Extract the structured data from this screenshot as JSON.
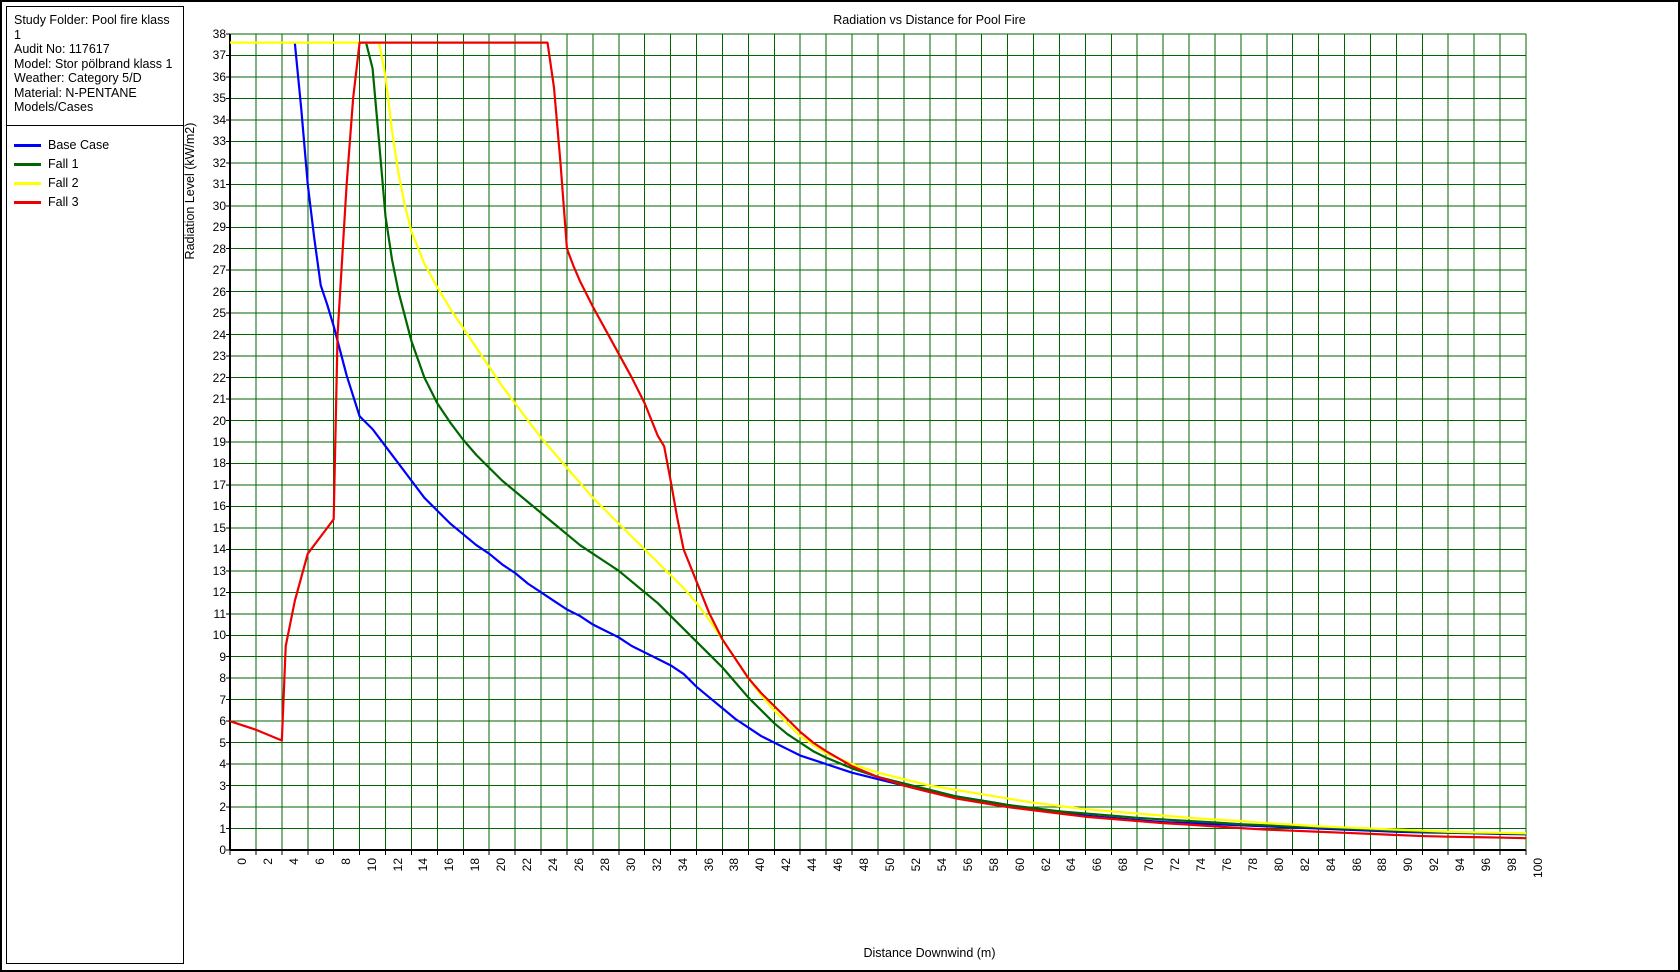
{
  "info": {
    "lines": [
      "Study Folder: Pool fire klass 1",
      "Audit No: 117617",
      "Model: Stor pölbrand klass 1",
      "Weather: Category 5/D",
      "Material: N-PENTANE",
      "Models/Cases"
    ]
  },
  "legend": {
    "items": [
      {
        "label": "Base Case",
        "color": "#0000ff"
      },
      {
        "label": "Fall 1",
        "color": "#006600"
      },
      {
        "label": "Fall 2",
        "color": "#ffff00"
      },
      {
        "label": "Fall 3",
        "color": "#ee0000"
      }
    ]
  },
  "chart_data": {
    "type": "line",
    "title": "Radiation vs Distance for Pool Fire",
    "xlabel": "Distance Downwind (m)",
    "ylabel": "Radiation Level (kW/m2)",
    "xlim": [
      0,
      100
    ],
    "ylim": [
      0,
      38
    ],
    "xticks": [
      0,
      2,
      4,
      6,
      8,
      10,
      12,
      14,
      16,
      18,
      20,
      22,
      24,
      26,
      28,
      30,
      32,
      34,
      36,
      38,
      40,
      42,
      44,
      46,
      48,
      50,
      52,
      54,
      56,
      58,
      60,
      62,
      64,
      66,
      68,
      70,
      72,
      74,
      76,
      78,
      80,
      82,
      84,
      86,
      88,
      90,
      92,
      94,
      96,
      98,
      100
    ],
    "yticks": [
      0,
      1,
      2,
      3,
      4,
      5,
      6,
      7,
      8,
      9,
      10,
      11,
      12,
      13,
      14,
      15,
      16,
      17,
      18,
      19,
      20,
      21,
      22,
      23,
      24,
      25,
      26,
      27,
      28,
      29,
      30,
      31,
      32,
      33,
      34,
      35,
      36,
      37,
      38
    ],
    "grid": true,
    "grid_color": "#006600",
    "legend_position": "left-panel",
    "series": [
      {
        "name": "Base Case",
        "color": "#0000ff",
        "x": [
          5.0,
          5.5,
          6.0,
          6.5,
          7.0,
          7.5,
          8.0,
          9.0,
          10.0,
          11.0,
          12.0,
          13.0,
          14.0,
          15.0,
          16.0,
          17.0,
          18.0,
          19.0,
          20.0,
          21.0,
          22.0,
          23.0,
          24.0,
          25.0,
          26.0,
          27.0,
          28.0,
          29.0,
          30.0,
          31.0,
          32.0,
          33.0,
          34.0,
          35.0,
          36.0,
          37.0,
          38.0,
          39.0,
          40.0,
          41.0,
          42.0,
          43.0,
          44.0,
          45.0,
          46.0,
          48.0,
          50.0,
          52.0,
          54.0,
          56.0,
          58.0,
          60.0,
          62.0,
          64.0,
          66.0,
          68.0,
          70.0,
          72.0,
          74.0,
          76.0,
          78.0,
          80.0,
          82.0,
          84.0,
          86.0,
          88.0,
          90.0,
          92.0,
          94.0,
          96.0,
          98.0,
          100.0
        ],
        "y": [
          37.6,
          34.5,
          31.0,
          28.5,
          26.3,
          25.4,
          24.4,
          22.1,
          20.2,
          19.6,
          18.8,
          18.0,
          17.2,
          16.4,
          15.8,
          15.2,
          14.7,
          14.2,
          13.8,
          13.3,
          12.9,
          12.4,
          12.0,
          11.6,
          11.2,
          10.9,
          10.5,
          10.2,
          9.9,
          9.5,
          9.2,
          8.9,
          8.6,
          8.2,
          7.6,
          7.1,
          6.6,
          6.1,
          5.7,
          5.3,
          5.0,
          4.7,
          4.4,
          4.2,
          4.0,
          3.6,
          3.3,
          3.0,
          2.7,
          2.5,
          2.3,
          2.1,
          1.9,
          1.8,
          1.6,
          1.5,
          1.4,
          1.3,
          1.25,
          1.2,
          1.15,
          1.1,
          1.05,
          1.0,
          0.95,
          0.9,
          0.85,
          0.82,
          0.8,
          0.78,
          0.75,
          0.73
        ]
      },
      {
        "name": "Fall 1",
        "color": "#006600",
        "x": [
          10.5,
          11.0,
          11.5,
          12.0,
          12.5,
          13.0,
          14.0,
          15.0,
          16.0,
          17.0,
          18.0,
          19.0,
          20.0,
          21.0,
          22.0,
          23.0,
          24.0,
          25.0,
          26.0,
          27.0,
          28.0,
          29.0,
          30.0,
          31.0,
          32.0,
          33.0,
          34.0,
          35.0,
          36.0,
          37.0,
          38.0,
          39.0,
          40.0,
          41.0,
          42.0,
          43.0,
          44.0,
          45.0,
          46.0,
          48.0,
          50.0,
          52.0,
          54.0,
          56.0,
          58.0,
          60.0,
          62.0,
          64.0,
          66.0,
          68.0,
          70.0,
          72.0,
          74.0,
          76.0,
          78.0,
          80.0,
          82.0,
          84.0,
          86.0,
          88.0,
          90.0,
          92.0,
          94.0,
          96.0,
          98.0,
          100.0
        ],
        "y": [
          37.6,
          36.4,
          33.0,
          29.5,
          27.5,
          26.0,
          23.7,
          22.0,
          20.8,
          19.9,
          19.1,
          18.4,
          17.8,
          17.2,
          16.7,
          16.2,
          15.7,
          15.2,
          14.7,
          14.2,
          13.8,
          13.4,
          13.0,
          12.5,
          12.0,
          11.5,
          10.9,
          10.3,
          9.7,
          9.1,
          8.5,
          7.8,
          7.1,
          6.5,
          5.9,
          5.4,
          5.0,
          4.6,
          4.3,
          3.8,
          3.4,
          3.1,
          2.8,
          2.5,
          2.3,
          2.1,
          1.95,
          1.8,
          1.7,
          1.6,
          1.5,
          1.42,
          1.35,
          1.28,
          1.2,
          1.15,
          1.1,
          1.05,
          1.0,
          0.95,
          0.9,
          0.85,
          0.82,
          0.8,
          0.78,
          0.75
        ]
      },
      {
        "name": "Fall 2",
        "color": "#ffff00",
        "x": [
          0.0,
          11.5,
          12.0,
          12.5,
          13.0,
          13.5,
          14.0,
          15.0,
          16.0,
          17.0,
          18.0,
          19.0,
          20.0,
          21.0,
          22.0,
          23.0,
          24.0,
          25.0,
          26.0,
          27.0,
          28.0,
          29.0,
          30.0,
          31.0,
          32.0,
          33.0,
          34.0,
          35.0,
          36.0,
          37.0,
          38.0,
          39.0,
          40.0,
          41.0,
          42.0,
          43.0,
          44.0,
          45.0,
          46.0,
          48.0,
          50.0,
          52.0,
          54.0,
          56.0,
          58.0,
          60.0,
          62.0,
          64.0,
          66.0,
          68.0,
          70.0,
          72.0,
          74.0,
          76.0,
          78.0,
          80.0,
          82.0,
          84.0,
          86.0,
          88.0,
          90.0,
          92.0,
          94.0,
          96.0,
          98.0,
          100.0
        ],
        "y": [
          37.6,
          37.6,
          36.0,
          33.5,
          31.5,
          30.0,
          28.8,
          27.3,
          26.2,
          25.2,
          24.3,
          23.4,
          22.5,
          21.6,
          20.8,
          20.0,
          19.2,
          18.5,
          17.8,
          17.1,
          16.4,
          15.8,
          15.2,
          14.6,
          14.0,
          13.4,
          12.8,
          12.2,
          11.5,
          10.7,
          9.8,
          8.9,
          8.0,
          7.2,
          6.5,
          5.9,
          5.3,
          4.9,
          4.5,
          4.0,
          3.6,
          3.3,
          3.0,
          2.8,
          2.6,
          2.4,
          2.2,
          2.05,
          1.9,
          1.8,
          1.7,
          1.6,
          1.5,
          1.42,
          1.35,
          1.25,
          1.18,
          1.1,
          1.05,
          1.0,
          0.95,
          0.9,
          0.85,
          0.82,
          0.8,
          0.78
        ]
      },
      {
        "name": "Fall 3",
        "color": "#ee0000",
        "x": [
          0.0,
          2.0,
          4.0,
          4.3,
          5.0,
          6.0,
          7.0,
          8.0,
          8.3,
          9.0,
          9.5,
          10.0,
          10.3,
          24.5,
          25.0,
          25.5,
          26.0,
          26.5,
          27.0,
          28.0,
          29.0,
          30.0,
          31.0,
          32.0,
          33.0,
          33.5,
          34.0,
          34.5,
          35.0,
          36.0,
          37.0,
          38.0,
          39.0,
          40.0,
          41.0,
          42.0,
          43.0,
          44.0,
          45.0,
          46.0,
          48.0,
          50.0,
          52.0,
          54.0,
          56.0,
          58.0,
          60.0,
          62.0,
          64.0,
          66.0,
          68.0,
          70.0,
          72.0,
          74.0,
          76.0,
          78.0,
          80.0,
          82.0,
          84.0,
          86.0,
          88.0,
          90.0,
          92.0,
          94.0,
          96.0,
          98.0,
          100.0
        ],
        "y": [
          6.0,
          5.6,
          5.1,
          9.5,
          11.6,
          13.8,
          14.6,
          15.4,
          24.0,
          31.0,
          35.0,
          37.6,
          37.6,
          37.6,
          35.5,
          32.0,
          28.0,
          27.2,
          26.5,
          25.3,
          24.2,
          23.1,
          22.0,
          20.8,
          19.3,
          18.8,
          17.2,
          15.5,
          14.0,
          12.5,
          11.0,
          9.8,
          8.9,
          8.0,
          7.3,
          6.7,
          6.1,
          5.5,
          5.0,
          4.6,
          3.9,
          3.4,
          3.0,
          2.7,
          2.4,
          2.2,
          2.0,
          1.85,
          1.7,
          1.55,
          1.45,
          1.35,
          1.25,
          1.18,
          1.1,
          1.02,
          0.95,
          0.9,
          0.85,
          0.8,
          0.75,
          0.7,
          0.65,
          0.62,
          0.6,
          0.58,
          0.55
        ]
      }
    ]
  }
}
